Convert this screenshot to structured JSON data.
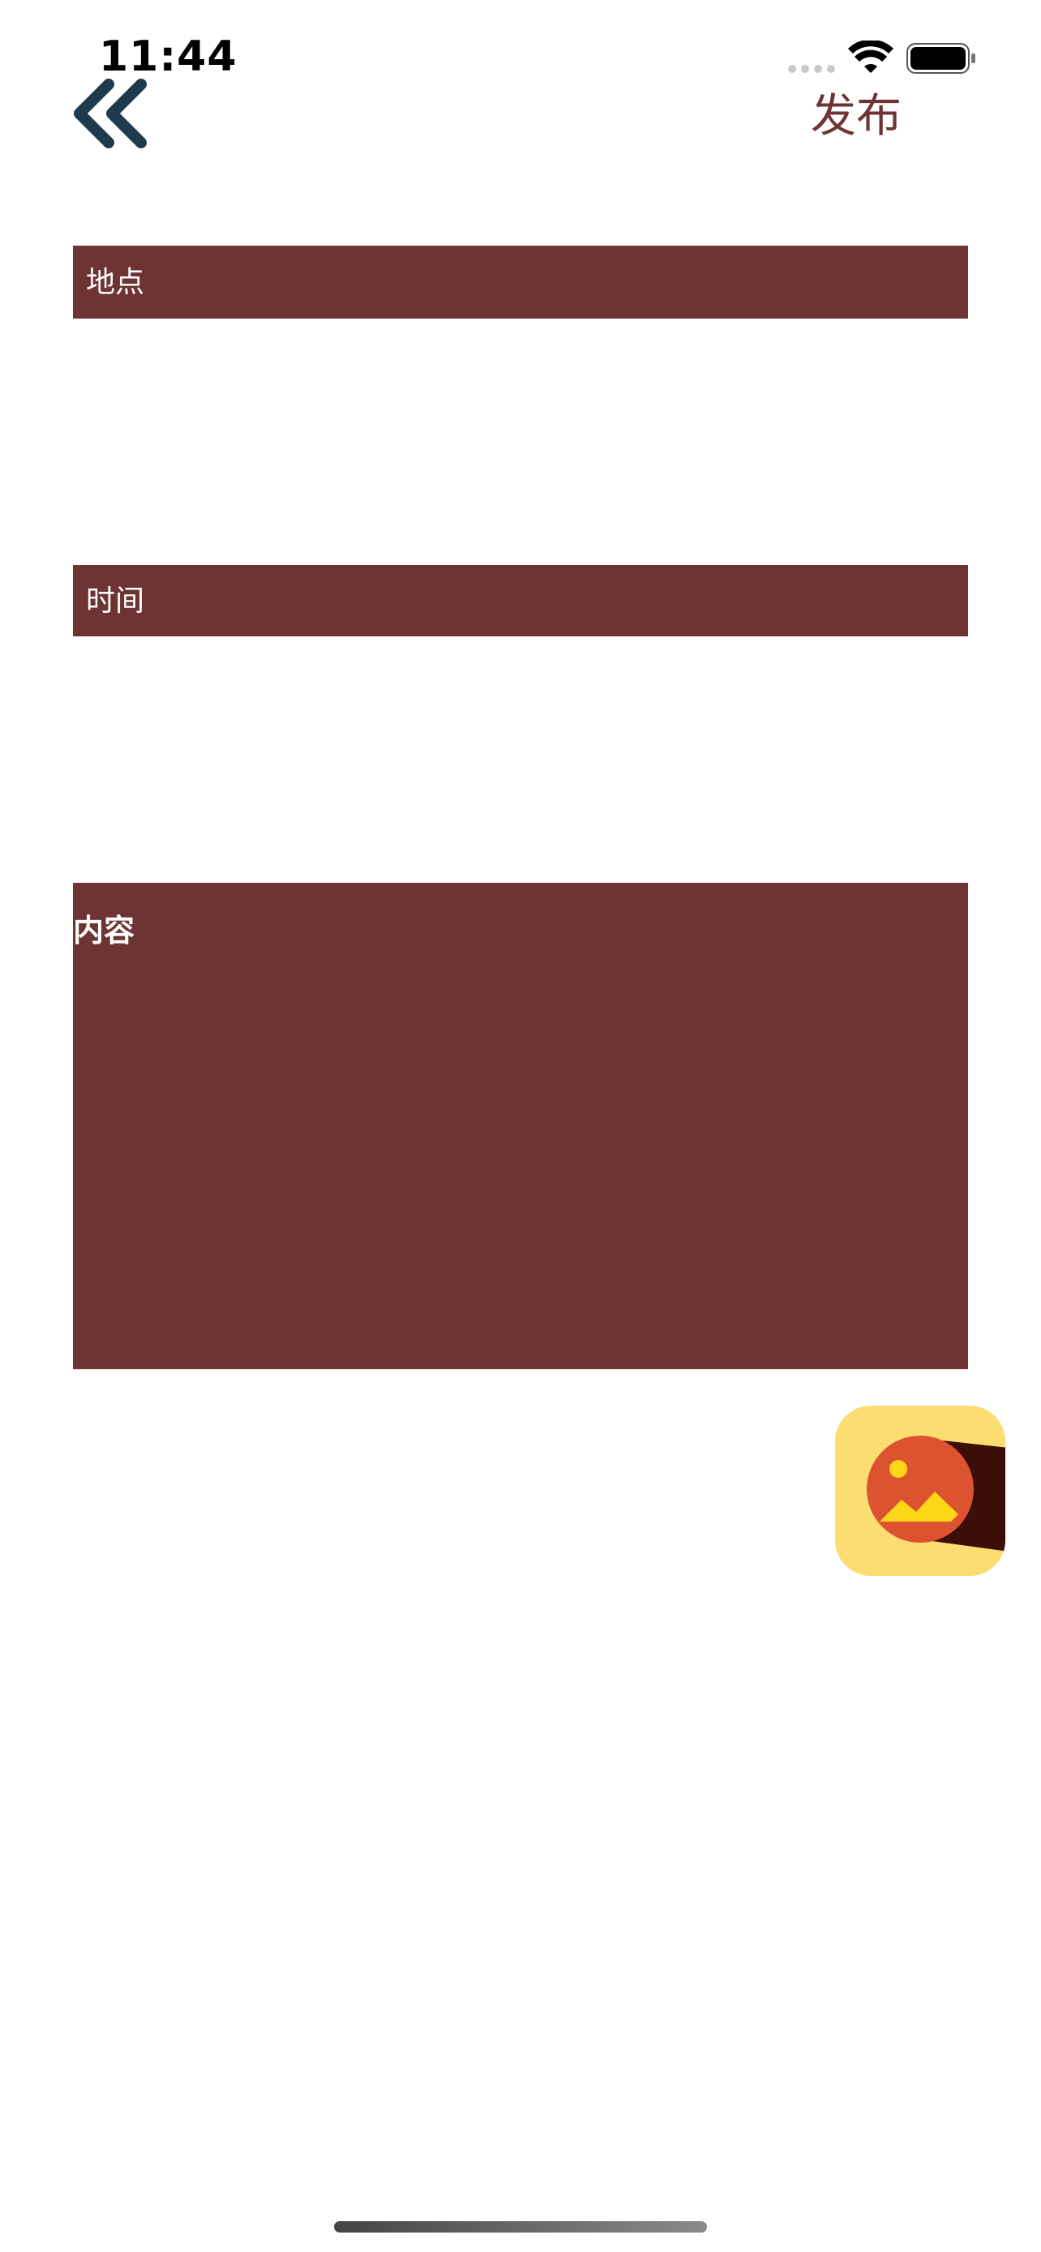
{
  "status_bar": {
    "time": "11:44",
    "wifi_icon": "wifi-icon",
    "battery_icon": "battery-icon"
  },
  "nav": {
    "back_icon": "double-chevron-left-icon",
    "publish_label": "发布"
  },
  "form": {
    "location_placeholder": "地点",
    "location_value": "",
    "time_placeholder": "时间",
    "time_value": "",
    "content_placeholder": "内容",
    "content_value": ""
  },
  "image_picker": {
    "icon": "image-picker-icon"
  },
  "colors": {
    "accent": "#6d3433",
    "back_icon": "#1f3a4d",
    "picker_bg": "#fbdd72",
    "picker_circle": "#dd522f",
    "picker_mountain": "#fdd718",
    "picker_shadow": "#3b0e08"
  }
}
